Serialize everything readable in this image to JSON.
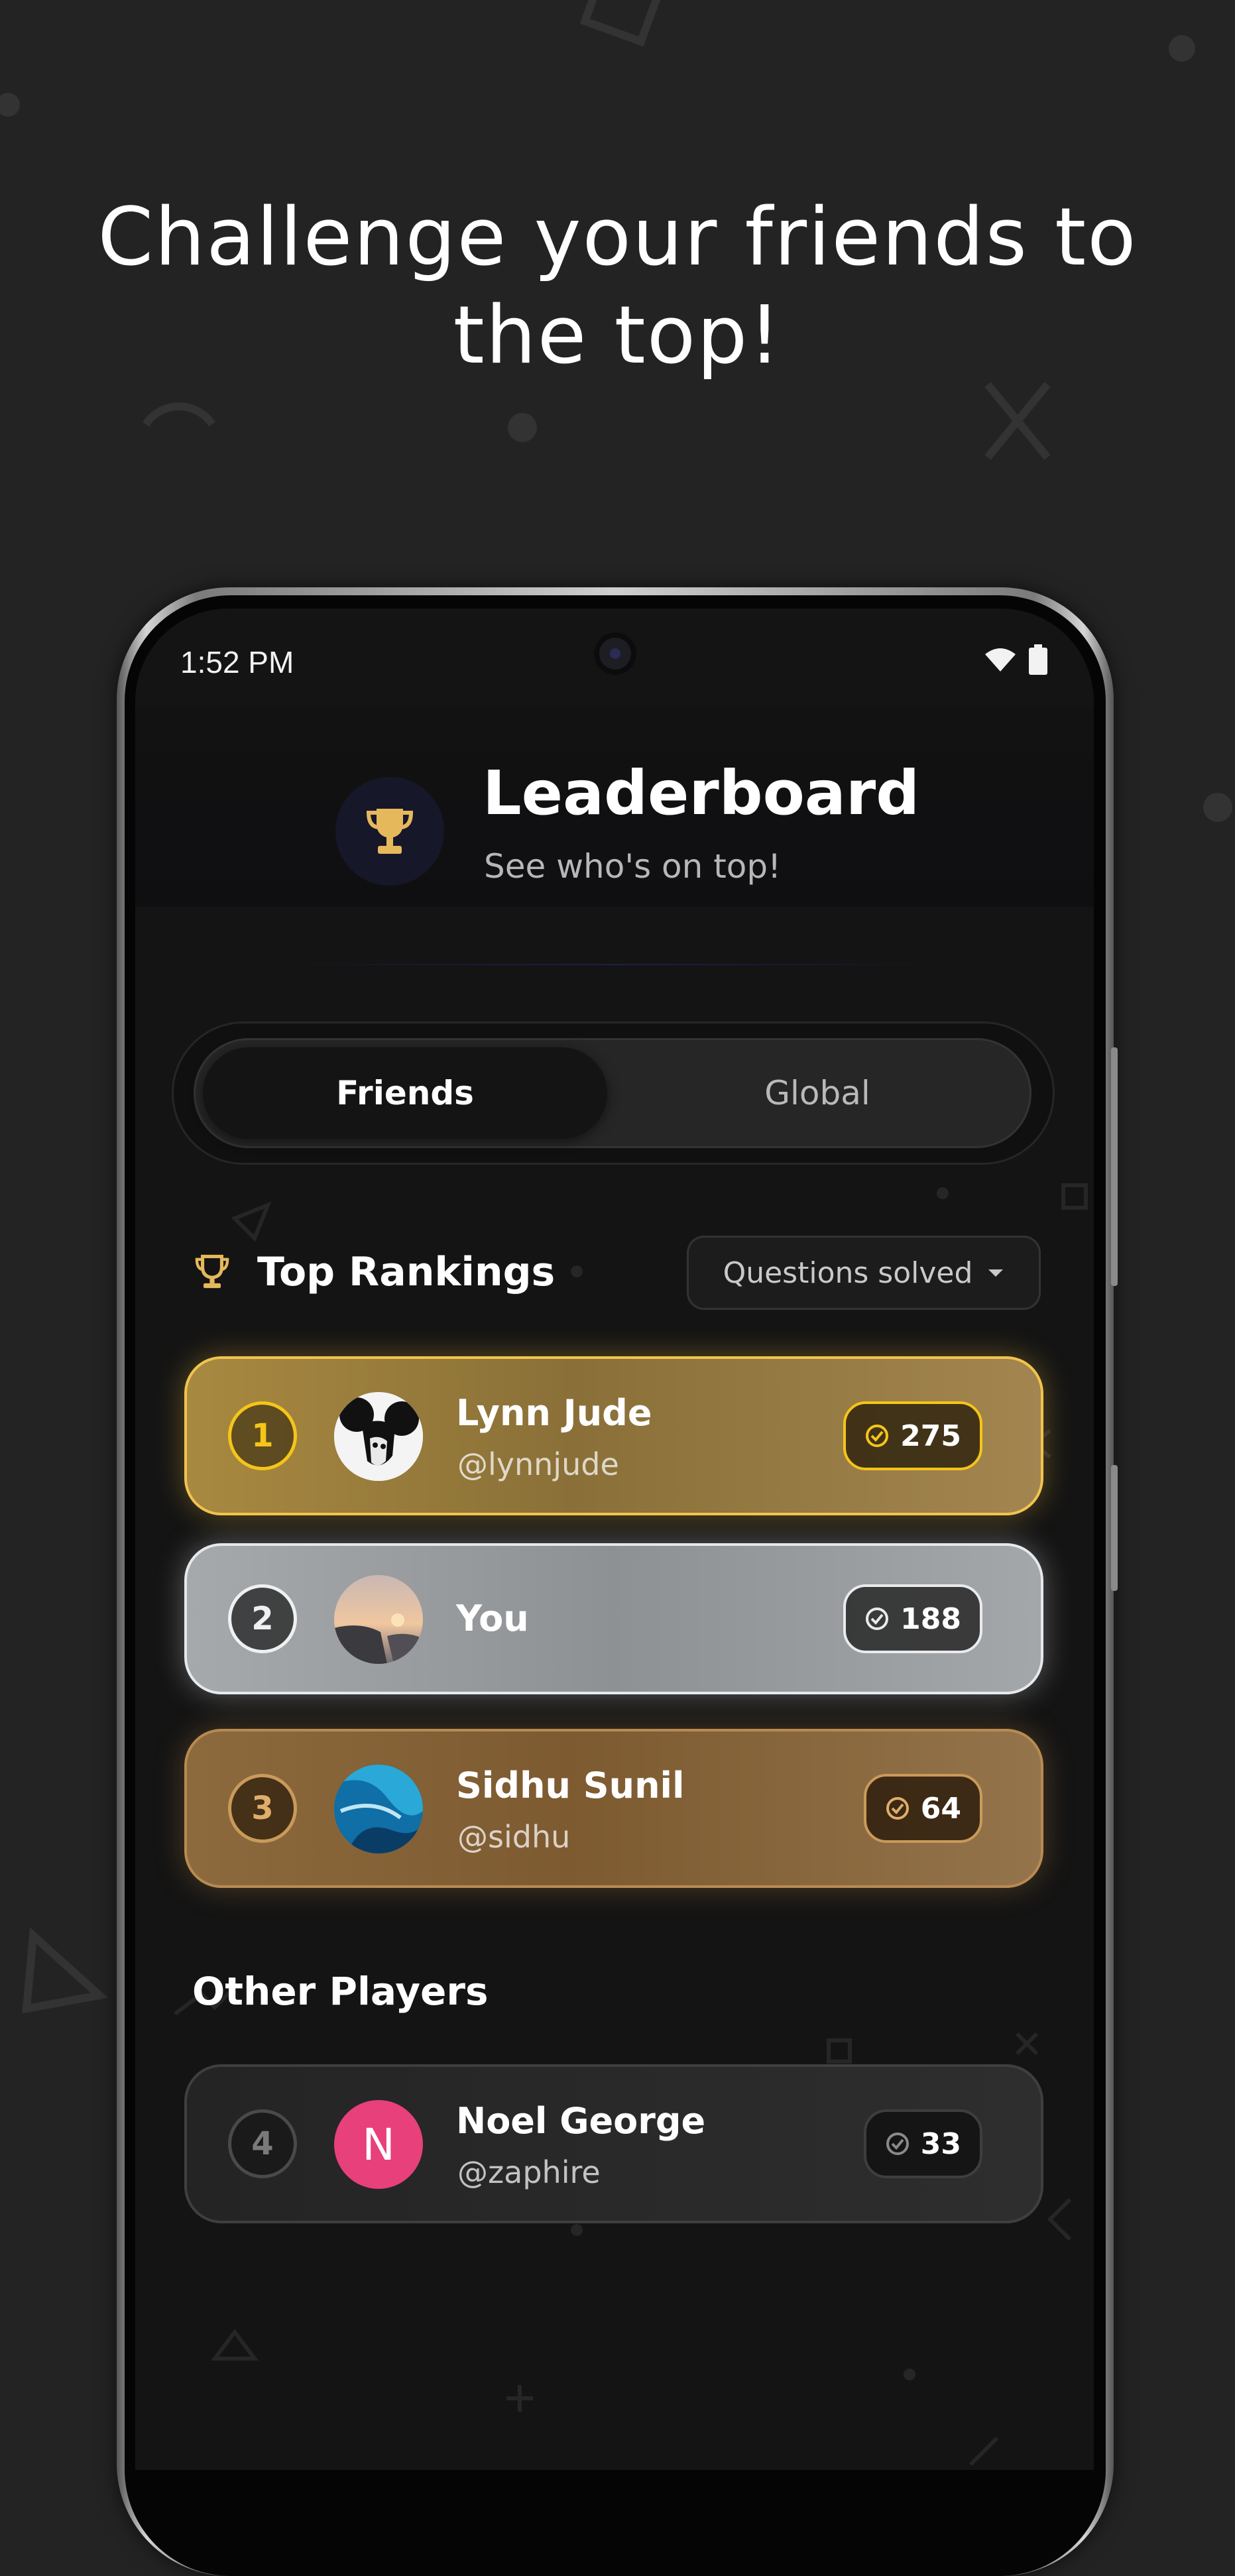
{
  "headline": {
    "line1": "Challenge your friends to",
    "line2": "the top!"
  },
  "status_bar": {
    "time": "1:52 PM",
    "icons": [
      "wifi-icon",
      "battery-icon"
    ]
  },
  "header": {
    "icon": "trophy-icon",
    "title": "Leaderboard",
    "subtitle": "See who's on top!"
  },
  "tabs": [
    {
      "label": "Friends",
      "selected": true
    },
    {
      "label": "Global",
      "selected": false
    }
  ],
  "rankings": {
    "icon": "trophy-icon",
    "title": "Top Rankings",
    "sort": {
      "value": "Questions solved",
      "icon": "caret-down-icon"
    }
  },
  "top_players": [
    {
      "rank": "1",
      "name": "Lynn Jude",
      "handle": "@lynnjude",
      "score": "275",
      "tier": "gold"
    },
    {
      "rank": "2",
      "name": "You",
      "handle": "",
      "score": "188",
      "tier": "silver"
    },
    {
      "rank": "3",
      "name": "Sidhu Sunil",
      "handle": "@sidhu",
      "score": "64",
      "tier": "bronze"
    }
  ],
  "other": {
    "title": "Other Players",
    "players": [
      {
        "rank": "4",
        "name": "Noel George",
        "handle": "@zaphire",
        "score": "33",
        "initial": "N"
      }
    ]
  },
  "colors": {
    "background": "#232323",
    "screen": "#141414",
    "gold": "#f2c44e",
    "silver": "#e6e9ec",
    "bronze": "#b88a52",
    "avatar_pink": "#e8407a",
    "trophy": "#e6b85c"
  }
}
